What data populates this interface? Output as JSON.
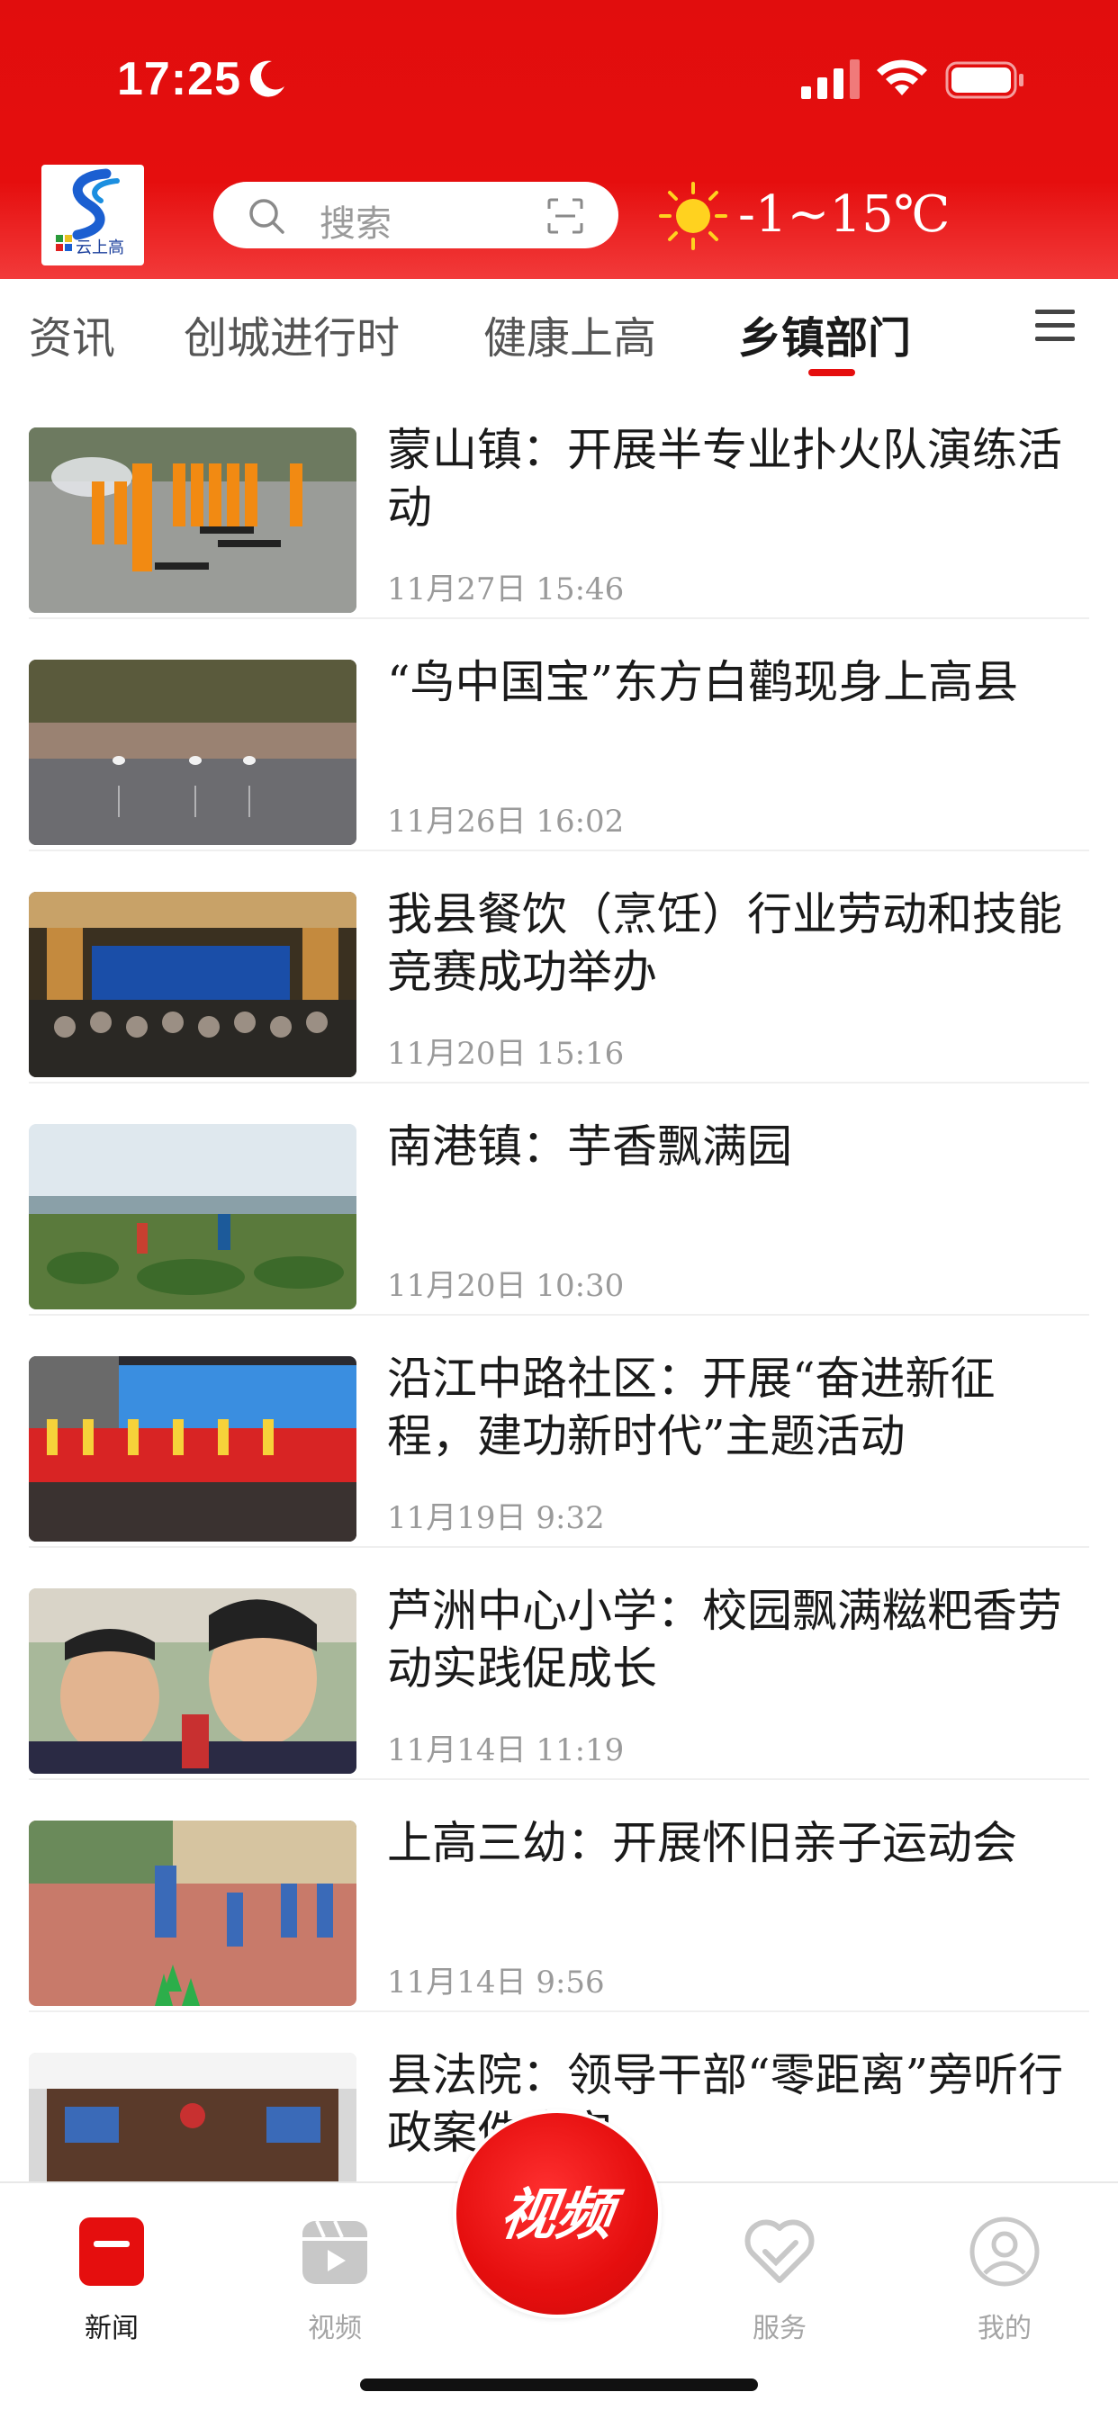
{
  "status_bar": {
    "time": "17:25"
  },
  "header": {
    "logo_text": "云上高",
    "search_placeholder": "搜索",
    "weather": "-1~15℃"
  },
  "tabs": [
    {
      "label": "资讯",
      "active": false
    },
    {
      "label": "创城进行时",
      "active": false
    },
    {
      "label": "健康上高",
      "active": false
    },
    {
      "label": "乡镇部门",
      "active": true
    }
  ],
  "news": [
    {
      "title": "蒙山镇：开展半专业扑火队演练活动",
      "time": "11月27日 15:46"
    },
    {
      "title": "“鸟中国宝”东方白鹳现身上高县",
      "time": "11月26日 16:02"
    },
    {
      "title": "我县餐饮（烹饪）行业劳动和技能竞赛成功举办",
      "time": "11月20日 15:16"
    },
    {
      "title": "南港镇：芋香飘满园",
      "time": "11月20日 10:30"
    },
    {
      "title": "沿江中路社区：开展“奋进新征程，建功新时代”主题活动",
      "time": "11月19日 9:32"
    },
    {
      "title": "芦洲中心小学：校园飘满糍粑香劳动实践促成长",
      "time": "11月14日 11:19"
    },
    {
      "title": "上高三幼：开展怀旧亲子运动会",
      "time": "11月14日 9:56"
    },
    {
      "title": "县法院：领导干部“零距离”旁听行政案件庭审",
      "time": ""
    }
  ],
  "tabbar": {
    "news": "新闻",
    "video": "视频",
    "center": "视频",
    "service": "服务",
    "mine": "我的"
  },
  "colors": {
    "brand_red": "#e50e0e",
    "muted": "#9a9a9a"
  }
}
